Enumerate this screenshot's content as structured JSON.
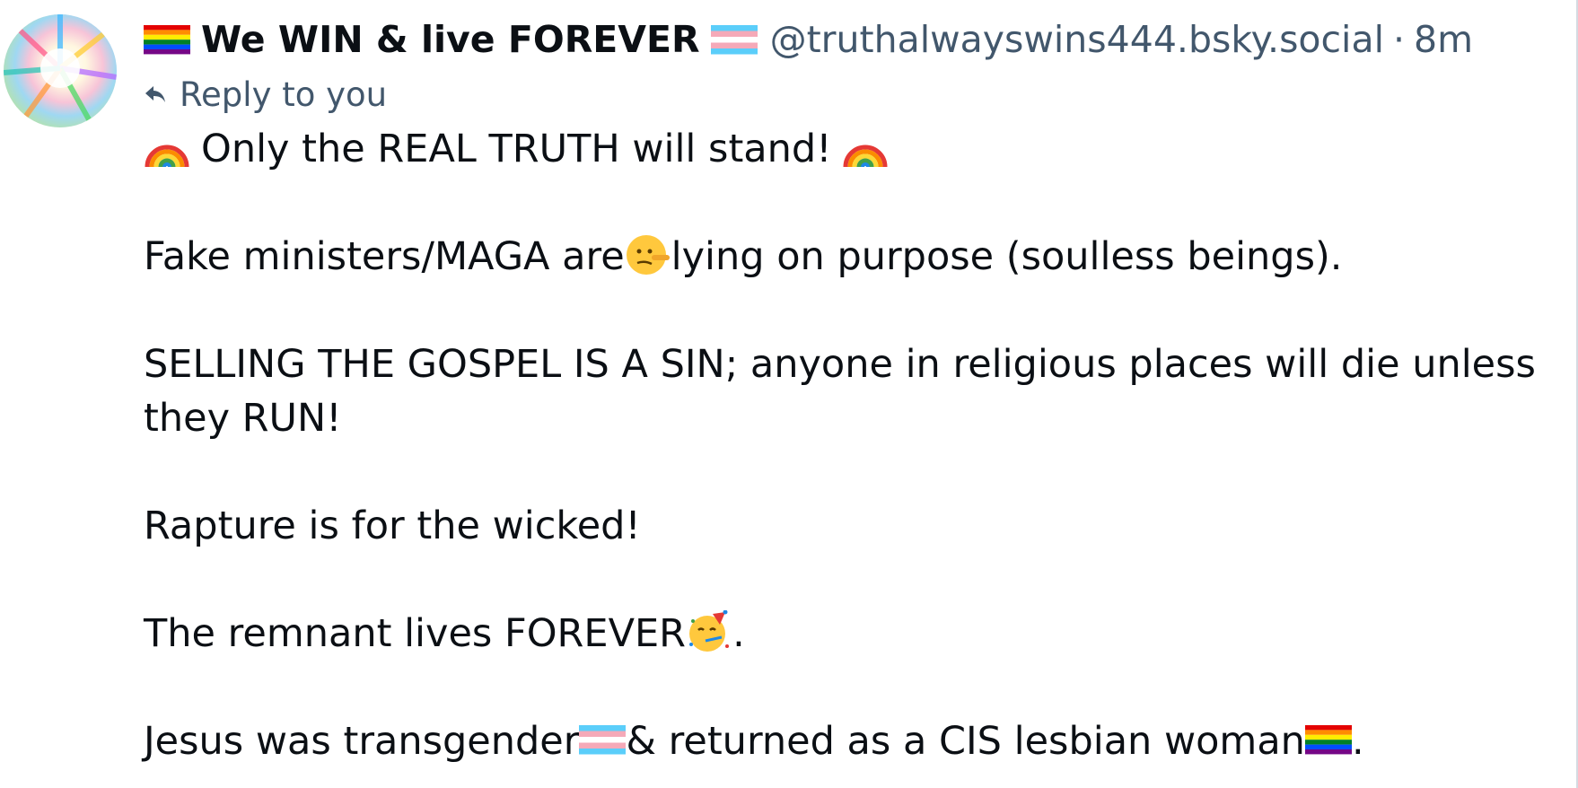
{
  "post": {
    "author_name": "We WIN & live FOREVER",
    "handle": "@truthalwayswins444.bsky.social",
    "separator": "·",
    "timestamp": "8m",
    "reply_label": "Reply to you",
    "lines": {
      "l1": "Only the REAL TRUTH will stand!",
      "l2a": "Fake ministers/MAGA are",
      "l2b": "lying on purpose (soulless beings).",
      "l3": "SELLING THE GOSPEL IS A SIN; anyone in religious places will die unless they RUN!",
      "l4": "Rapture is for the wicked!",
      "l5a": "The remnant lives FOREVER",
      "l5b": ".",
      "l6a": "Jesus was transgender",
      "l6b": "& returned as a CIS lesbian woman",
      "l6c": "."
    }
  },
  "icons": {
    "rainbow_flag": "rainbow-flag-icon",
    "trans_flag": "transgender-flag-icon",
    "rainbow": "rainbow-icon",
    "lying_face": "lying-face-icon",
    "partying_face": "partying-face-icon",
    "reply": "reply-arrow-icon"
  },
  "colors": {
    "text": "#0b0f14",
    "muted": "#42576c"
  }
}
